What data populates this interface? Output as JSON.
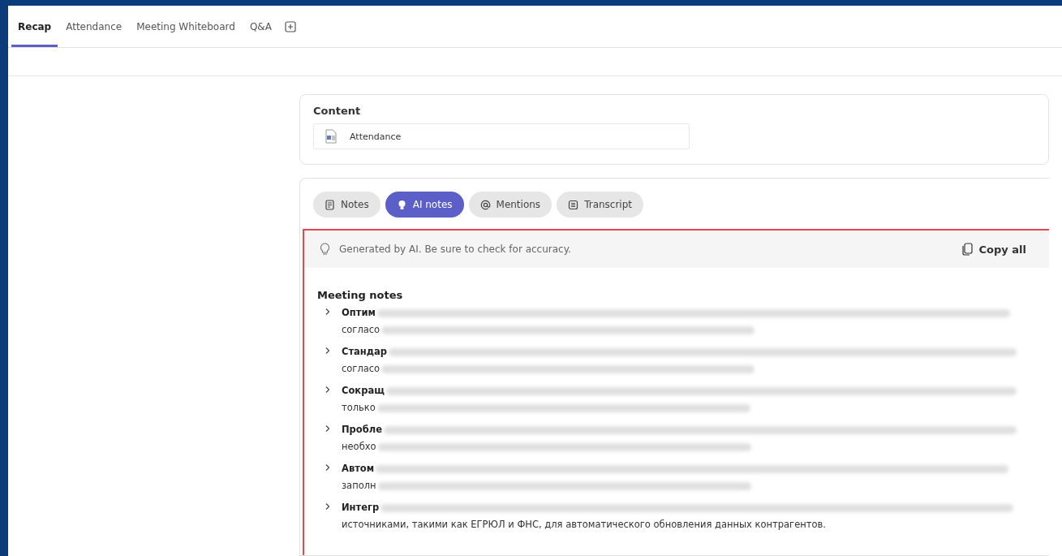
{
  "tabs": [
    {
      "label": "Recap",
      "selected": true
    },
    {
      "label": "Attendance",
      "selected": false
    },
    {
      "label": "Meeting Whiteboard",
      "selected": false
    },
    {
      "label": "Q&A",
      "selected": false
    }
  ],
  "content": {
    "title": "Content",
    "file": "Attendance"
  },
  "note_tabs": [
    {
      "label": "Notes",
      "kind": "notes",
      "selected": false
    },
    {
      "label": "AI notes",
      "kind": "ai",
      "selected": true
    },
    {
      "label": "Mentions",
      "kind": "mentions",
      "selected": false
    },
    {
      "label": "Transcript",
      "kind": "transcript",
      "selected": false
    }
  ],
  "disclaimer": "Generated by AI. Be sure to check for accuracy.",
  "copy_all": "Copy all",
  "meeting_notes": {
    "title": "Meeting notes",
    "items": [
      {
        "heading": "Оптим",
        "continuation": "согласо",
        "expanded": false
      },
      {
        "heading": "Стандар",
        "continuation": "согласо",
        "expanded": false
      },
      {
        "heading": "Сокращ",
        "continuation": "только",
        "expanded": false
      },
      {
        "heading": "Пробле",
        "continuation": "необхо",
        "expanded": false
      },
      {
        "heading": "Автом",
        "continuation": "заполн",
        "expanded": false
      },
      {
        "heading": "Интегр",
        "continuation": "источниками, такими как ЕГРЮЛ и ФНС, для автоматического обновления данных контрагентов.",
        "expanded": false
      }
    ]
  }
}
